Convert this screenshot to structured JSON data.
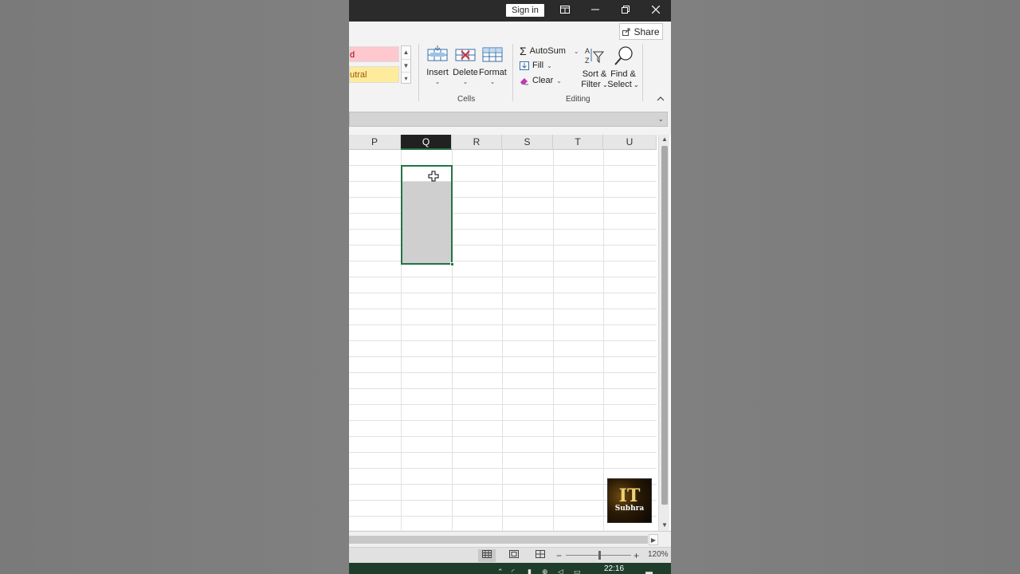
{
  "titlebar": {
    "signin_label": "Sign in"
  },
  "ribbon": {
    "share_label": "Share",
    "styles": {
      "bad_label": "d",
      "neutral_label": "utral"
    },
    "cells_group": {
      "insert_label": "Insert",
      "delete_label": "Delete",
      "format_label": "Format",
      "group_label": "Cells"
    },
    "editing_group": {
      "autosum_label": "AutoSum",
      "fill_label": "Fill",
      "clear_label": "Clear",
      "sort_filter_label_1": "Sort &",
      "sort_filter_label_2": "Filter",
      "find_select_label_1": "Find &",
      "find_select_label_2": "Select",
      "group_label": "Editing"
    }
  },
  "sheet": {
    "columns": [
      "P",
      "Q",
      "R",
      "S",
      "T",
      "U"
    ],
    "active_column": "Q"
  },
  "logo": {
    "line1": "IT",
    "line2": "Subhra"
  },
  "statusbar": {
    "zoom_label": "120%",
    "zoom_percent": 120
  },
  "taskbar": {
    "clock": "22:16"
  },
  "colors": {
    "accent": "#217346",
    "bad_fill": "#ffc7ce",
    "neutral_fill": "#ffeb9c",
    "active_header": "#212121"
  }
}
